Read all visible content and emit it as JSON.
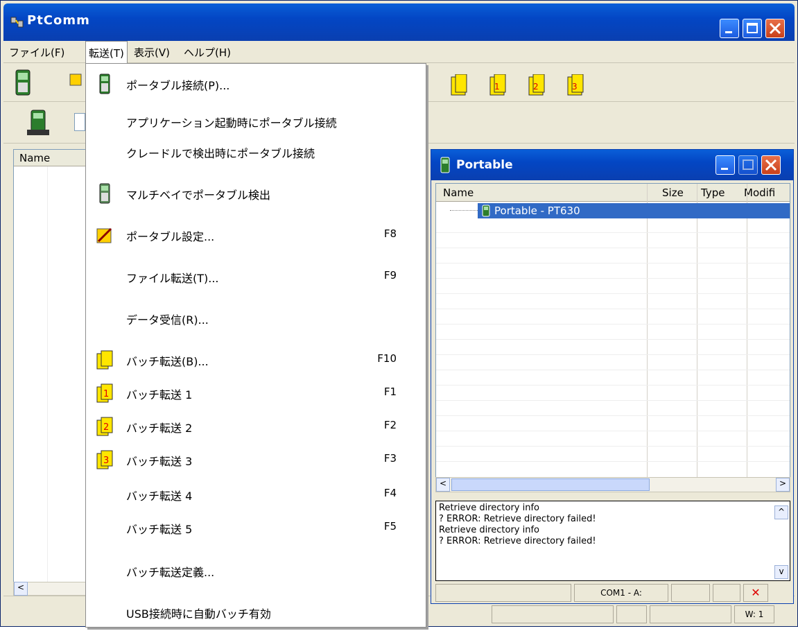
{
  "app": {
    "title": "PtComm"
  },
  "menubar": {
    "items": [
      {
        "label": "ファイル(F)"
      },
      {
        "label": "転送(T)"
      },
      {
        "label": "表示(V)"
      },
      {
        "label": "ヘルプ(H)"
      }
    ]
  },
  "left_list": {
    "header": "Name"
  },
  "dropdown": {
    "items": [
      {
        "label": "ポータブル接続(P)...",
        "shortcut": "",
        "icon": "portable-device-icon"
      },
      {
        "label": "アプリケーション起動時にポータブル接続",
        "shortcut": "",
        "icon": ""
      },
      {
        "label": "クレードルで検出時にポータブル接続",
        "shortcut": "",
        "icon": ""
      },
      {
        "label": "マルチベイでポータブル検出",
        "shortcut": "",
        "icon": "portable-device-icon"
      },
      {
        "label": "ポータブル設定...",
        "shortcut": "F8",
        "icon": "settings-tools-icon"
      },
      {
        "label": "ファイル転送(T)...",
        "shortcut": "F9",
        "icon": ""
      },
      {
        "label": "データ受信(R)...",
        "shortcut": "",
        "icon": ""
      },
      {
        "label": "バッチ転送(B)...",
        "shortcut": "F10",
        "icon": "batch-transfer-icon"
      },
      {
        "label": "バッチ転送 1",
        "shortcut": "F1",
        "icon": "batch-transfer-1-icon"
      },
      {
        "label": "バッチ転送 2",
        "shortcut": "F2",
        "icon": "batch-transfer-2-icon"
      },
      {
        "label": "バッチ転送 3",
        "shortcut": "F3",
        "icon": "batch-transfer-3-icon"
      },
      {
        "label": "バッチ転送 4",
        "shortcut": "F4",
        "icon": ""
      },
      {
        "label": "バッチ転送 5",
        "shortcut": "F5",
        "icon": ""
      },
      {
        "label": "バッチ転送定義...",
        "shortcut": "",
        "icon": ""
      },
      {
        "label": "USB接続時に自動バッチ有効",
        "shortcut": "",
        "icon": ""
      }
    ]
  },
  "portable_window": {
    "title": "Portable",
    "columns": [
      "Name",
      "Size",
      "Type",
      "Modifi"
    ],
    "selected_item": "Portable - PT630",
    "log": [
      "Retrieve directory info",
      "? ERROR: Retrieve directory failed!",
      "Retrieve directory info",
      "? ERROR: Retrieve directory failed!"
    ],
    "status_port": "COM1 - A:"
  },
  "main_status": {
    "w_label": "W: 1"
  },
  "colors": {
    "titlebar": "#0346c4",
    "selection": "#316ac5",
    "menu_bg": "#ffffff",
    "window_bg": "#ece9d8"
  }
}
